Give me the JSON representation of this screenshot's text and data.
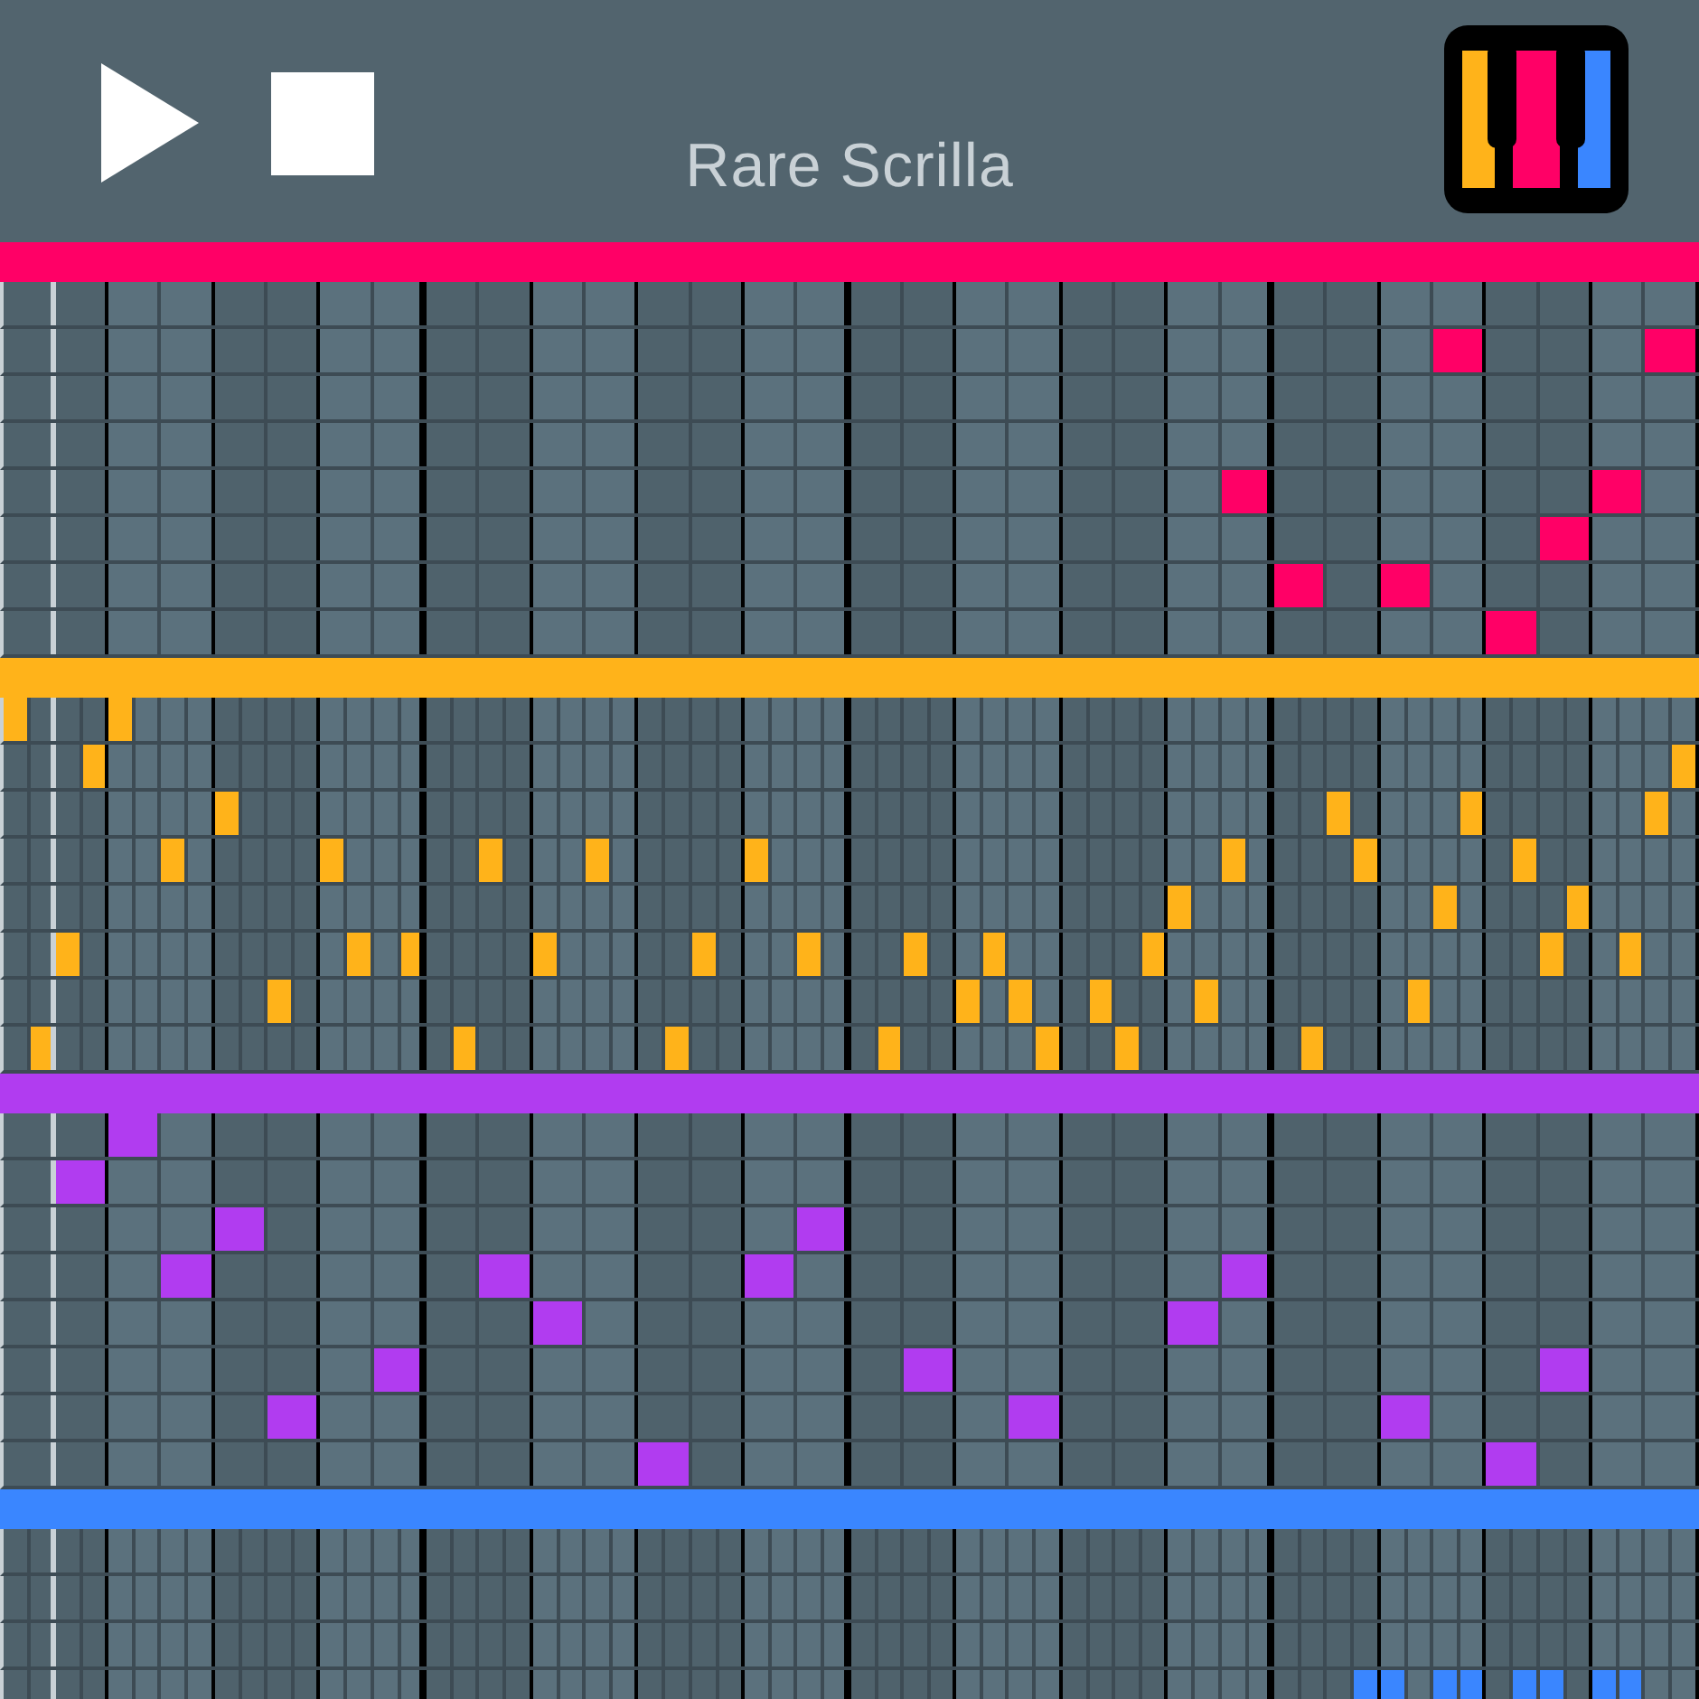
{
  "header": {
    "title": "Rare Scrilla"
  },
  "tracks": [
    {
      "color": "#ff0066",
      "rows": [
        {
          "cells": [
            false,
            false,
            false,
            false,
            false,
            false,
            false,
            false,
            false,
            false,
            false,
            false,
            false,
            false,
            false,
            false,
            false,
            false,
            false,
            false,
            false,
            false,
            false,
            false,
            false,
            false,
            false,
            false,
            false,
            false,
            false,
            false
          ]
        },
        {
          "cells": [
            false,
            false,
            false,
            false,
            false,
            false,
            false,
            false,
            false,
            false,
            false,
            false,
            false,
            false,
            false,
            false,
            false,
            false,
            false,
            false,
            false,
            false,
            false,
            false,
            false,
            false,
            false,
            true,
            false,
            false,
            false,
            true
          ]
        },
        {
          "cells": [
            false,
            false,
            false,
            false,
            false,
            false,
            false,
            false,
            false,
            false,
            false,
            false,
            false,
            false,
            false,
            false,
            false,
            false,
            false,
            false,
            false,
            false,
            false,
            false,
            false,
            false,
            false,
            false,
            false,
            false,
            false,
            false
          ]
        },
        {
          "cells": [
            false,
            false,
            false,
            false,
            false,
            false,
            false,
            false,
            false,
            false,
            false,
            false,
            false,
            false,
            false,
            false,
            false,
            false,
            false,
            false,
            false,
            false,
            false,
            false,
            false,
            false,
            false,
            false,
            false,
            false,
            false,
            false
          ]
        },
        {
          "cells": [
            false,
            false,
            false,
            false,
            false,
            false,
            false,
            false,
            false,
            false,
            false,
            false,
            false,
            false,
            false,
            false,
            false,
            false,
            false,
            false,
            false,
            false,
            false,
            true,
            false,
            false,
            false,
            false,
            false,
            false,
            true,
            false
          ]
        },
        {
          "cells": [
            false,
            false,
            false,
            false,
            false,
            false,
            false,
            false,
            false,
            false,
            false,
            false,
            false,
            false,
            false,
            false,
            false,
            false,
            false,
            false,
            false,
            false,
            false,
            false,
            false,
            false,
            false,
            false,
            false,
            true,
            false,
            false
          ]
        },
        {
          "cells": [
            false,
            false,
            false,
            false,
            false,
            false,
            false,
            false,
            false,
            false,
            false,
            false,
            false,
            false,
            false,
            false,
            false,
            false,
            false,
            false,
            false,
            false,
            false,
            false,
            true,
            false,
            true,
            false,
            false,
            false,
            false,
            false
          ]
        },
        {
          "cells": [
            false,
            false,
            false,
            false,
            false,
            false,
            false,
            false,
            false,
            false,
            false,
            false,
            false,
            false,
            false,
            false,
            false,
            false,
            false,
            false,
            false,
            false,
            false,
            false,
            false,
            false,
            false,
            false,
            true,
            false,
            false,
            false
          ]
        }
      ]
    },
    {
      "color": "#ffb31a",
      "rows": [
        {
          "cells": [
            true,
            false,
            false,
            false,
            true,
            false,
            false,
            false,
            false,
            false,
            false,
            false,
            false,
            false,
            false,
            false,
            false,
            false,
            false,
            false,
            false,
            false,
            false,
            false,
            false,
            false,
            false,
            false,
            false,
            false,
            false,
            false,
            false,
            false,
            false,
            false,
            false,
            false,
            false,
            false,
            false,
            false,
            false,
            false,
            false,
            false,
            false,
            false,
            false,
            false,
            false,
            false,
            false,
            false,
            false,
            false,
            false,
            false,
            false,
            false,
            false,
            false,
            false,
            false
          ]
        },
        {
          "cells": [
            false,
            false,
            false,
            true,
            false,
            false,
            false,
            false,
            false,
            false,
            false,
            false,
            false,
            false,
            false,
            false,
            false,
            false,
            false,
            false,
            false,
            false,
            false,
            false,
            false,
            false,
            false,
            false,
            false,
            false,
            false,
            false,
            false,
            false,
            false,
            false,
            false,
            false,
            false,
            false,
            false,
            false,
            false,
            false,
            false,
            false,
            false,
            false,
            false,
            false,
            false,
            false,
            false,
            false,
            false,
            false,
            false,
            false,
            false,
            false,
            false,
            false,
            false,
            true
          ]
        },
        {
          "cells": [
            false,
            false,
            false,
            false,
            false,
            false,
            false,
            false,
            true,
            false,
            false,
            false,
            false,
            false,
            false,
            false,
            false,
            false,
            false,
            false,
            false,
            false,
            false,
            false,
            false,
            false,
            false,
            false,
            false,
            false,
            false,
            false,
            false,
            false,
            false,
            false,
            false,
            false,
            false,
            false,
            false,
            false,
            false,
            false,
            false,
            false,
            false,
            false,
            false,
            false,
            true,
            false,
            false,
            false,
            false,
            true,
            false,
            false,
            false,
            false,
            false,
            false,
            true,
            false
          ]
        },
        {
          "cells": [
            false,
            false,
            false,
            false,
            false,
            false,
            true,
            false,
            false,
            false,
            false,
            false,
            true,
            false,
            false,
            false,
            false,
            false,
            true,
            false,
            false,
            false,
            true,
            false,
            false,
            false,
            false,
            false,
            true,
            false,
            false,
            false,
            false,
            false,
            false,
            false,
            false,
            false,
            false,
            false,
            false,
            false,
            false,
            false,
            false,
            false,
            true,
            false,
            false,
            false,
            false,
            true,
            false,
            false,
            false,
            false,
            false,
            true,
            false,
            false,
            false,
            false,
            false,
            false
          ]
        },
        {
          "cells": [
            false,
            false,
            false,
            false,
            false,
            false,
            false,
            false,
            false,
            false,
            false,
            false,
            false,
            false,
            false,
            false,
            false,
            false,
            false,
            false,
            false,
            false,
            false,
            false,
            false,
            false,
            false,
            false,
            false,
            false,
            false,
            false,
            false,
            false,
            false,
            false,
            false,
            false,
            false,
            false,
            false,
            false,
            false,
            false,
            true,
            false,
            false,
            false,
            false,
            false,
            false,
            false,
            false,
            false,
            true,
            false,
            false,
            false,
            false,
            true,
            false,
            false,
            false,
            false
          ]
        },
        {
          "cells": [
            false,
            false,
            true,
            false,
            false,
            false,
            false,
            false,
            false,
            false,
            false,
            false,
            false,
            true,
            false,
            true,
            false,
            false,
            false,
            false,
            true,
            false,
            false,
            false,
            false,
            false,
            true,
            false,
            false,
            false,
            true,
            false,
            false,
            false,
            true,
            false,
            false,
            true,
            false,
            false,
            false,
            false,
            false,
            true,
            false,
            false,
            false,
            false,
            false,
            false,
            false,
            false,
            false,
            false,
            false,
            false,
            false,
            false,
            true,
            false,
            false,
            true,
            false,
            false
          ]
        },
        {
          "cells": [
            false,
            false,
            false,
            false,
            false,
            false,
            false,
            false,
            false,
            false,
            true,
            false,
            false,
            false,
            false,
            false,
            false,
            false,
            false,
            false,
            false,
            false,
            false,
            false,
            false,
            false,
            false,
            false,
            false,
            false,
            false,
            false,
            false,
            false,
            false,
            false,
            true,
            false,
            true,
            false,
            false,
            true,
            false,
            false,
            false,
            true,
            false,
            false,
            false,
            false,
            false,
            false,
            false,
            true,
            false,
            false,
            false,
            false,
            false,
            false,
            false,
            false,
            false,
            false
          ]
        },
        {
          "cells": [
            false,
            true,
            false,
            false,
            false,
            false,
            false,
            false,
            false,
            false,
            false,
            false,
            false,
            false,
            false,
            false,
            false,
            true,
            false,
            false,
            false,
            false,
            false,
            false,
            false,
            true,
            false,
            false,
            false,
            false,
            false,
            false,
            false,
            true,
            false,
            false,
            false,
            false,
            false,
            true,
            false,
            false,
            true,
            false,
            false,
            false,
            false,
            false,
            false,
            true,
            false,
            false,
            false,
            false,
            false,
            false,
            false,
            false,
            false,
            false,
            false,
            false,
            false,
            false
          ]
        }
      ]
    },
    {
      "color": "#b13cf0",
      "rows": [
        {
          "cells": [
            false,
            false,
            true,
            false,
            false,
            false,
            false,
            false,
            false,
            false,
            false,
            false,
            false,
            false,
            false,
            false,
            false,
            false,
            false,
            false,
            false,
            false,
            false,
            false,
            false,
            false,
            false,
            false,
            false,
            false,
            false,
            false
          ]
        },
        {
          "cells": [
            false,
            true,
            false,
            false,
            false,
            false,
            false,
            false,
            false,
            false,
            false,
            false,
            false,
            false,
            false,
            false,
            false,
            false,
            false,
            false,
            false,
            false,
            false,
            false,
            false,
            false,
            false,
            false,
            false,
            false,
            false,
            false
          ]
        },
        {
          "cells": [
            false,
            false,
            false,
            false,
            true,
            false,
            false,
            false,
            false,
            false,
            false,
            false,
            false,
            false,
            false,
            true,
            false,
            false,
            false,
            false,
            false,
            false,
            false,
            false,
            false,
            false,
            false,
            false,
            false,
            false,
            false,
            false
          ]
        },
        {
          "cells": [
            false,
            false,
            false,
            true,
            false,
            false,
            false,
            false,
            false,
            true,
            false,
            false,
            false,
            false,
            true,
            false,
            false,
            false,
            false,
            false,
            false,
            false,
            false,
            true,
            false,
            false,
            false,
            false,
            false,
            false,
            false,
            false
          ]
        },
        {
          "cells": [
            false,
            false,
            false,
            false,
            false,
            false,
            false,
            false,
            false,
            false,
            true,
            false,
            false,
            false,
            false,
            false,
            false,
            false,
            false,
            false,
            false,
            false,
            true,
            false,
            false,
            false,
            false,
            false,
            false,
            false,
            false,
            false
          ]
        },
        {
          "cells": [
            false,
            false,
            false,
            false,
            false,
            false,
            false,
            true,
            false,
            false,
            false,
            false,
            false,
            false,
            false,
            false,
            false,
            true,
            false,
            false,
            false,
            false,
            false,
            false,
            false,
            false,
            false,
            false,
            false,
            true,
            false,
            false
          ]
        },
        {
          "cells": [
            false,
            false,
            false,
            false,
            false,
            true,
            false,
            false,
            false,
            false,
            false,
            false,
            false,
            false,
            false,
            false,
            false,
            false,
            false,
            true,
            false,
            false,
            false,
            false,
            false,
            false,
            true,
            false,
            false,
            false,
            false,
            false
          ]
        },
        {
          "cells": [
            false,
            false,
            false,
            false,
            false,
            false,
            false,
            false,
            false,
            false,
            false,
            false,
            true,
            false,
            false,
            false,
            false,
            false,
            false,
            false,
            false,
            false,
            false,
            false,
            false,
            false,
            false,
            false,
            true,
            false,
            false,
            false
          ]
        }
      ]
    },
    {
      "color": "#3a86ff",
      "rows": [
        {
          "cells": [
            false,
            false,
            false,
            false,
            false,
            false,
            false,
            false,
            false,
            false,
            false,
            false,
            false,
            false,
            false,
            false,
            false,
            false,
            false,
            false,
            false,
            false,
            false,
            false,
            false,
            false,
            false,
            false,
            false,
            false,
            false,
            false,
            false,
            false,
            false,
            false,
            false,
            false,
            false,
            false,
            false,
            false,
            false,
            false,
            false,
            false,
            false,
            false,
            false,
            false,
            false,
            false,
            false,
            false,
            false,
            false,
            false,
            false,
            false,
            false,
            false,
            false,
            false,
            false
          ]
        },
        {
          "cells": [
            false,
            false,
            false,
            false,
            false,
            false,
            false,
            false,
            false,
            false,
            false,
            false,
            false,
            false,
            false,
            false,
            false,
            false,
            false,
            false,
            false,
            false,
            false,
            false,
            false,
            false,
            false,
            false,
            false,
            false,
            false,
            false,
            false,
            false,
            false,
            false,
            false,
            false,
            false,
            false,
            false,
            false,
            false,
            false,
            false,
            false,
            false,
            false,
            false,
            false,
            false,
            false,
            false,
            false,
            false,
            false,
            false,
            false,
            false,
            false,
            false,
            false,
            false,
            false
          ]
        },
        {
          "cells": [
            false,
            false,
            false,
            false,
            false,
            false,
            false,
            false,
            false,
            false,
            false,
            false,
            false,
            false,
            false,
            false,
            false,
            false,
            false,
            false,
            false,
            false,
            false,
            false,
            false,
            false,
            false,
            false,
            false,
            false,
            false,
            false,
            false,
            false,
            false,
            false,
            false,
            false,
            false,
            false,
            false,
            false,
            false,
            false,
            false,
            false,
            false,
            false,
            false,
            false,
            false,
            false,
            false,
            false,
            false,
            false,
            false,
            false,
            false,
            false,
            false,
            false,
            false,
            false
          ]
        },
        {
          "cells": [
            false,
            false,
            false,
            false,
            false,
            false,
            false,
            false,
            false,
            false,
            false,
            false,
            false,
            false,
            false,
            false,
            false,
            false,
            false,
            false,
            false,
            false,
            false,
            false,
            false,
            false,
            false,
            false,
            false,
            false,
            false,
            false,
            false,
            false,
            false,
            false,
            false,
            false,
            false,
            false,
            false,
            false,
            false,
            false,
            false,
            false,
            false,
            false,
            false,
            false,
            false,
            true,
            true,
            false,
            true,
            true,
            false,
            true,
            true,
            false,
            true,
            true,
            false,
            false
          ]
        }
      ]
    }
  ]
}
